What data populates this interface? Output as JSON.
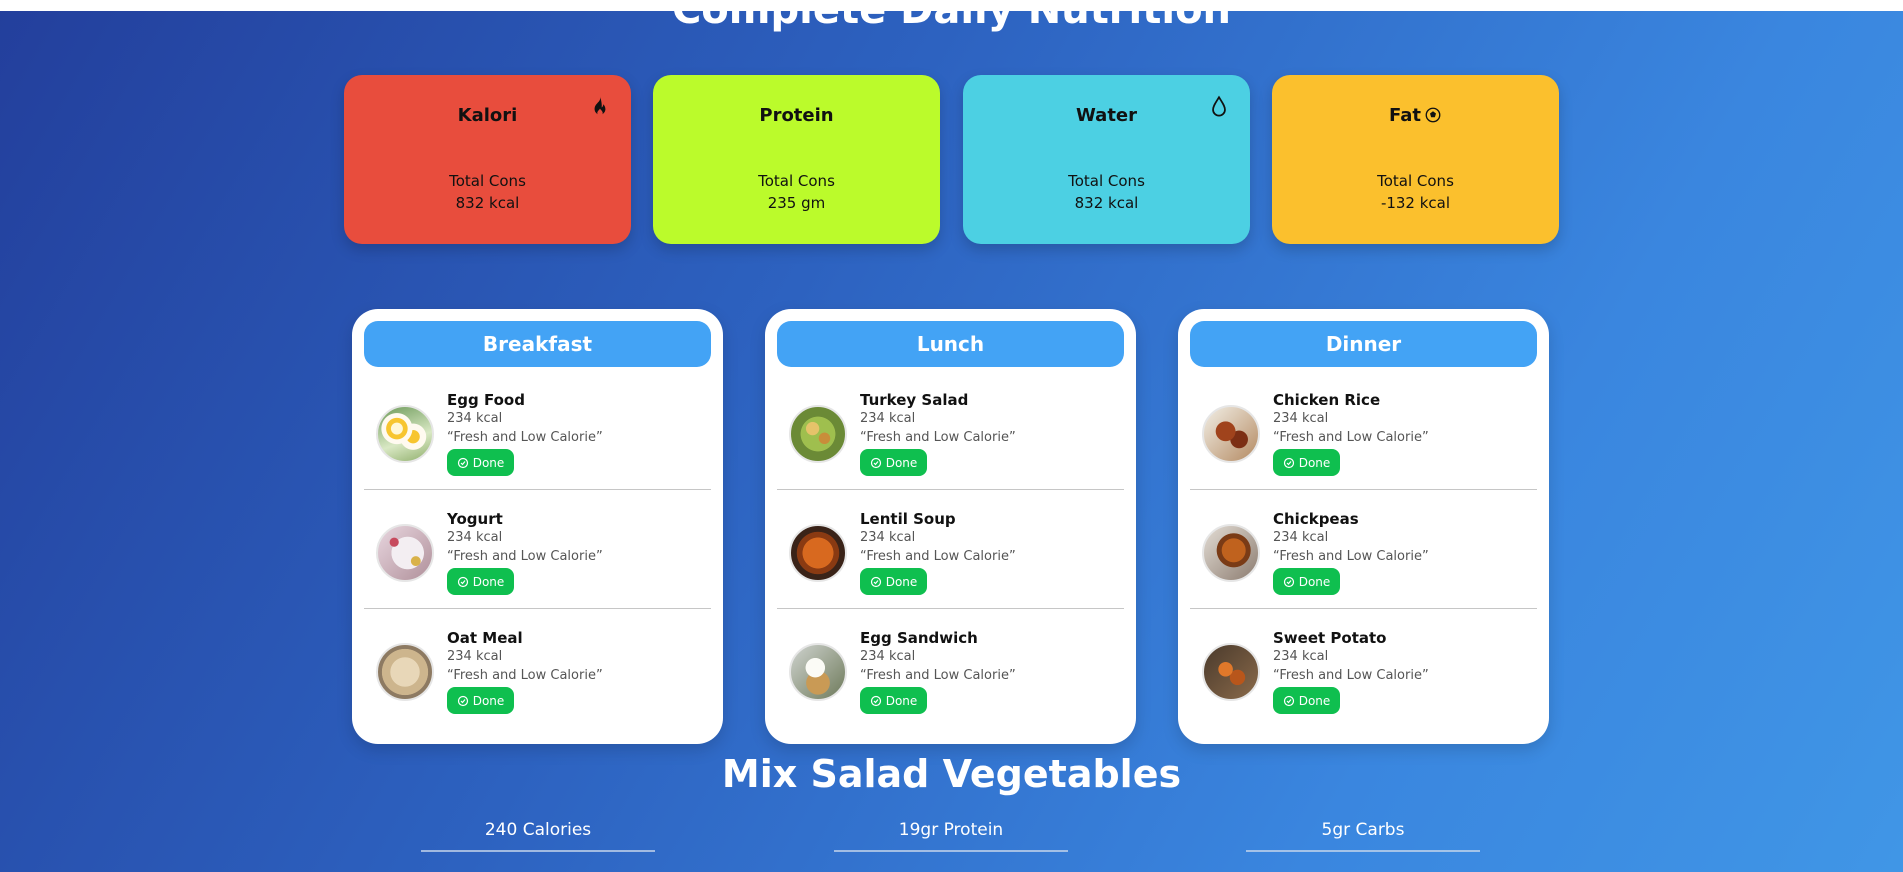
{
  "page": {
    "title": "Complete Daily Nutrition"
  },
  "stats": [
    {
      "title": "Kalori",
      "label": "Total Cons",
      "value": "832 kcal",
      "color": "#e84d3d",
      "icon": "fire-icon"
    },
    {
      "title": "Protein",
      "label": "Total Cons",
      "value": "235 gm",
      "color": "#bbfb2b",
      "icon": ""
    },
    {
      "title": "Water",
      "label": "Total Cons",
      "value": "832 kcal",
      "color": "#4cd0e3",
      "icon": "water-drop-icon"
    },
    {
      "title": "Fat",
      "label": "Total Cons",
      "value": "-132 kcal",
      "color": "#fbc02d",
      "icon": "fat-icon"
    }
  ],
  "meals": [
    {
      "header": "Breakfast",
      "items": [
        {
          "name": "Egg Food",
          "kcal": "234 kcal",
          "desc": "“Fresh and Low Calorie”",
          "done": "Done",
          "image": "egg-food-image"
        },
        {
          "name": "Yogurt",
          "kcal": "234 kcal",
          "desc": "“Fresh and Low Calorie”",
          "done": "Done",
          "image": "yogurt-image"
        },
        {
          "name": "Oat Meal",
          "kcal": "234 kcal",
          "desc": "“Fresh and Low Calorie”",
          "done": "Done",
          "image": "oat-meal-image"
        }
      ]
    },
    {
      "header": "Lunch",
      "items": [
        {
          "name": "Turkey Salad",
          "kcal": "234 kcal",
          "desc": "“Fresh and Low Calorie”",
          "done": "Done",
          "image": "turkey-salad-image"
        },
        {
          "name": "Lentil Soup",
          "kcal": "234 kcal",
          "desc": "“Fresh and Low Calorie”",
          "done": "Done",
          "image": "lentil-soup-image"
        },
        {
          "name": "Egg Sandwich",
          "kcal": "234 kcal",
          "desc": "“Fresh and Low Calorie”",
          "done": "Done",
          "image": "egg-sandwich-image"
        }
      ]
    },
    {
      "header": "Dinner",
      "items": [
        {
          "name": "Chicken Rice",
          "kcal": "234 kcal",
          "desc": "“Fresh and Low Calorie”",
          "done": "Done",
          "image": "chicken-rice-image"
        },
        {
          "name": "Chickpeas",
          "kcal": "234 kcal",
          "desc": "“Fresh and Low Calorie”",
          "done": "Done",
          "image": "chickpeas-image"
        },
        {
          "name": "Sweet Potato",
          "kcal": "234 kcal",
          "desc": "“Fresh and Low Calorie”",
          "done": "Done",
          "image": "sweet-potato-image"
        }
      ]
    }
  ],
  "salad": {
    "title": "Mix Salad Vegetables",
    "calories": "240 Calories",
    "protein": "19gr Protein",
    "carbs": "5gr Carbs"
  }
}
